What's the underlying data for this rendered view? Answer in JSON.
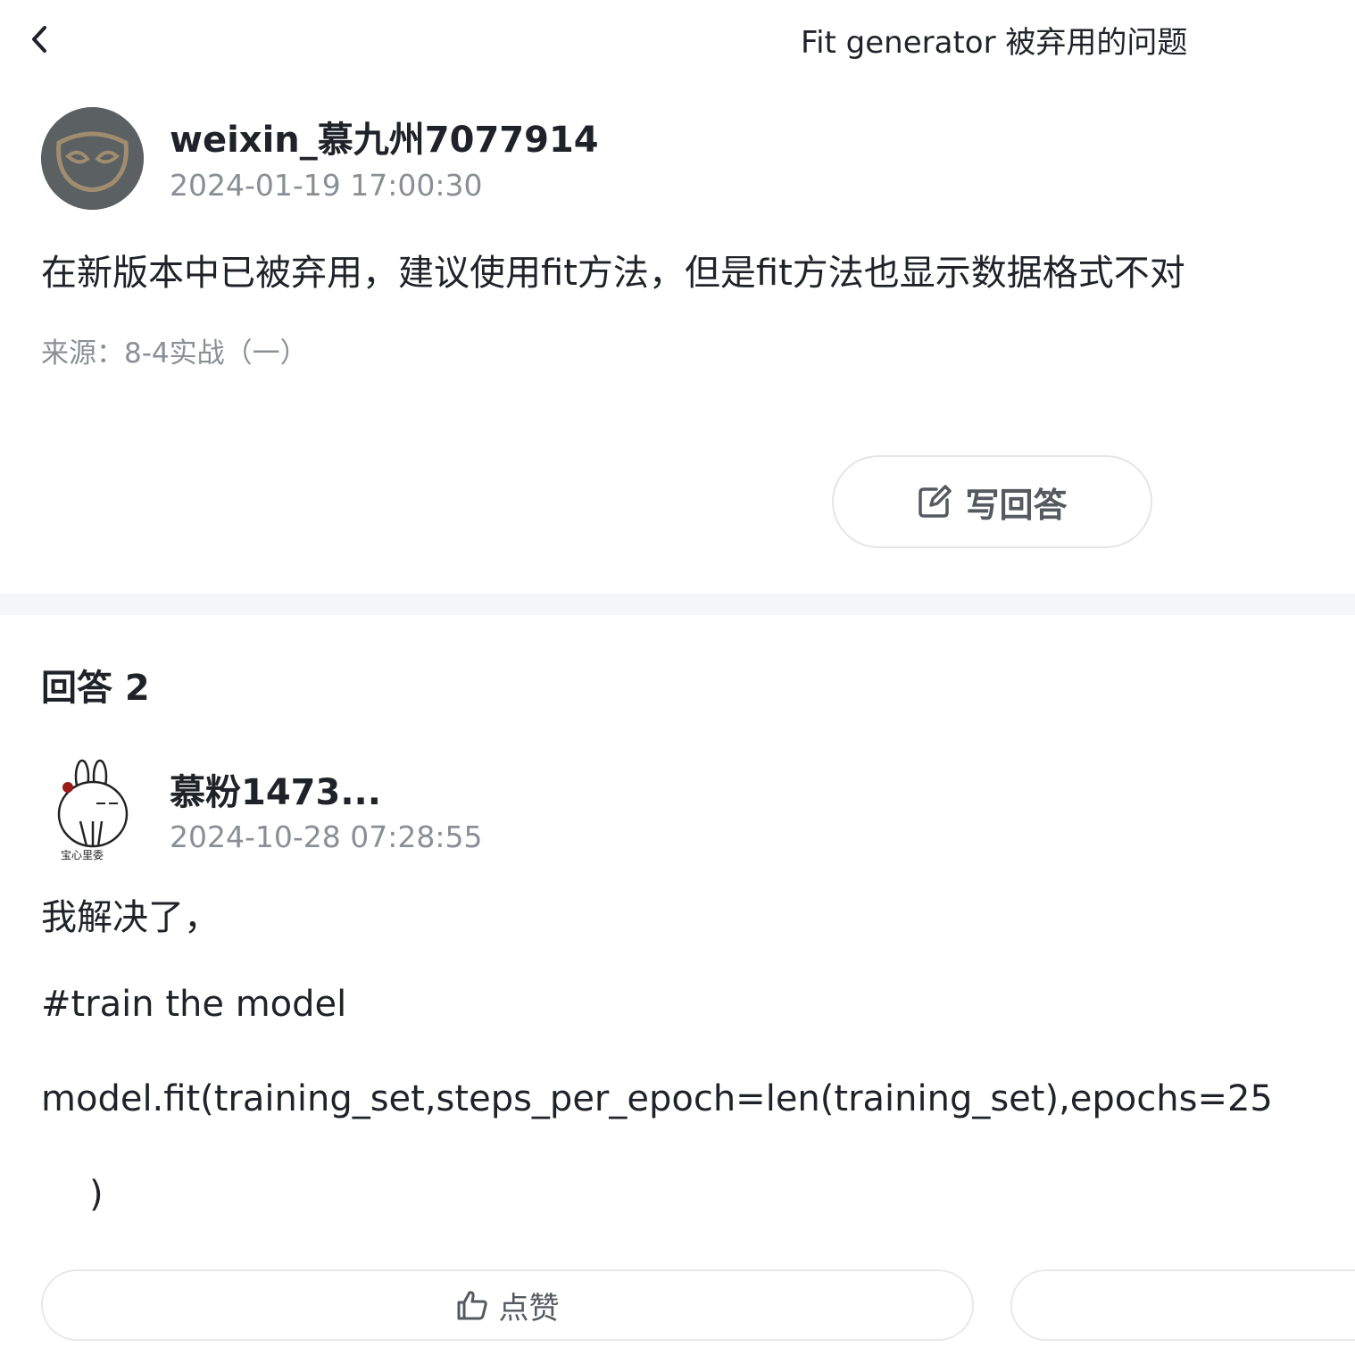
{
  "header": {
    "back_icon": "chevron-left-icon",
    "title": "Fit generator 被弃用的问题"
  },
  "question": {
    "author": "weixin_慕九州7077914",
    "time": "2024-01-19 17:00:30",
    "body": "在新版本中已被弃用，建议使用fit方法，但是fit方法也显示数据格式不对",
    "source": "来源：8-4实战（一）",
    "avatar_icon": "mask-avatar-icon",
    "avatar_bg": "#5b6062",
    "avatar_accent": "#a08c6e"
  },
  "actions": {
    "write_answer_label": "写回答",
    "write_answer_icon": "edit-icon"
  },
  "answers": {
    "heading": "回答 2",
    "items": [
      {
        "author": "慕粉1473...",
        "time": "2024-10-28 07:28:55",
        "avatar_icon": "bunny-avatar-icon",
        "lines": [
          "我解决了，",
          "#train the model",
          "model.fit(training_set,steps_per_epoch=len(training_set),epochs=25",
          ")"
        ],
        "like_label": "点赞",
        "like_icon": "thumbs-up-icon"
      }
    ]
  }
}
